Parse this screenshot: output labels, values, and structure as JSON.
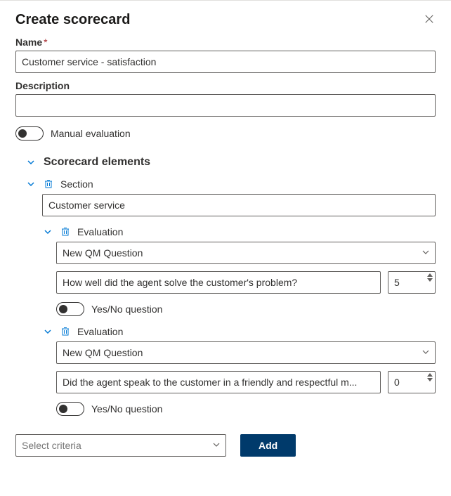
{
  "header": {
    "title": "Create scorecard"
  },
  "fields": {
    "name_label": "Name",
    "name_value": "Customer service - satisfaction",
    "description_label": "Description",
    "description_value": "",
    "manual_eval_label": "Manual evaluation"
  },
  "elements_header": "Scorecard elements",
  "section": {
    "label": "Section",
    "name_value": "Customer service",
    "evaluations": [
      {
        "label": "Evaluation",
        "dropdown_value": "New QM Question",
        "question_text": "How well did the agent solve the customer's problem?",
        "score": "5",
        "yesno_label": "Yes/No question"
      },
      {
        "label": "Evaluation",
        "dropdown_value": "New QM Question",
        "question_text": "Did the agent speak to the customer in a friendly and respectful m...",
        "score": "0",
        "yesno_label": "Yes/No question"
      }
    ]
  },
  "footer": {
    "criteria_placeholder": "Select criteria",
    "add_label": "Add"
  }
}
